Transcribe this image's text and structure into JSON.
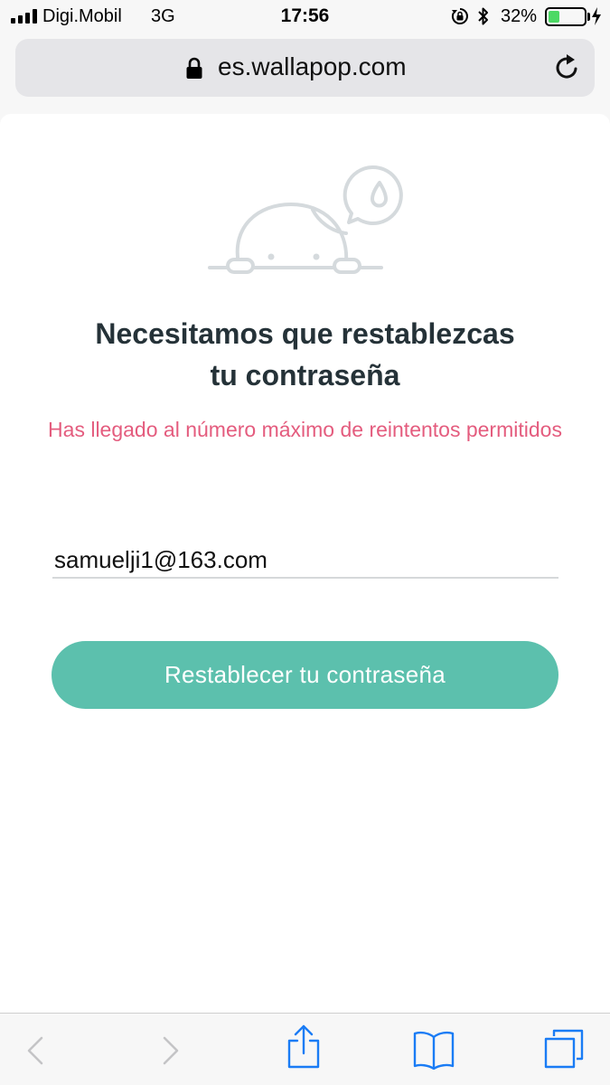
{
  "status_bar": {
    "carrier": "Digi.Mobil",
    "network": "3G",
    "time": "17:56",
    "battery_percent": "32%",
    "battery_level": 0.32
  },
  "browser": {
    "url": "es.wallapop.com"
  },
  "page": {
    "heading_line1": "Necesitamos que restablezcas",
    "heading_line2": "tu contraseña",
    "error_message": "Has llegado al número máximo de reintentos permitidos",
    "email_value": "samuelji1@163.com",
    "reset_button_label": "Restablecer tu contraseña"
  },
  "colors": {
    "accent": "#5cc0ad",
    "error": "#e45c7e",
    "heading": "#253238",
    "ios_blue": "#1a7cf5"
  },
  "toolbar": {
    "icons": [
      "back-icon",
      "forward-icon",
      "share-icon",
      "bookmarks-icon",
      "tabs-icon"
    ]
  }
}
